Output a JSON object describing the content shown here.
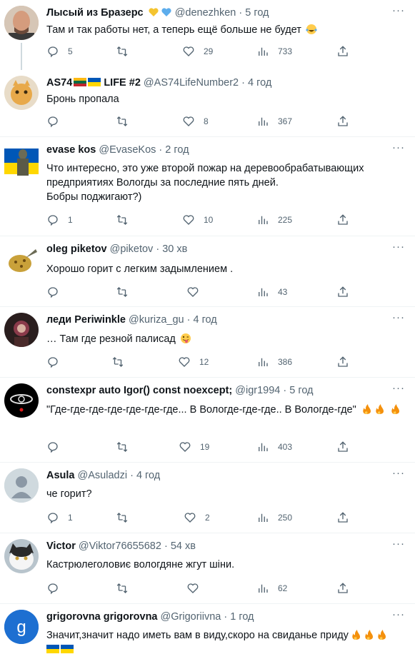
{
  "tweets": [
    {
      "name": "Лысый из Бразерс",
      "handle": "@denezhken",
      "sep": " · ",
      "time": "5 год",
      "text": "Там и так работы нет, а теперь ещё больше не будет",
      "replies": "5",
      "retweets": "",
      "likes": "29",
      "views": "733"
    },
    {
      "name": "AS74",
      "name2": "LIFE #2",
      "handle": "@AS74LifeNumber2",
      "sep": " · ",
      "time": "4 год",
      "text": "Бронь пропала",
      "replies": "",
      "retweets": "",
      "likes": "8",
      "views": "367"
    },
    {
      "name": "evase kos",
      "handle": "@EvaseKos",
      "sep": " · ",
      "time": "2 год",
      "text": "Что интересно, это уже второй пожар на деревообрабатывающих\nпредприятиях Вологды за последние пять дней.\nБобры поджигают?)",
      "replies": "1",
      "retweets": "",
      "likes": "10",
      "views": "225"
    },
    {
      "name": "oleg piketov",
      "handle": "@piketov",
      "sep": " · ",
      "time": "30 хв",
      "text": "Хорошо горит с легким задымлением .",
      "replies": "",
      "retweets": "",
      "likes": "",
      "views": "43"
    },
    {
      "name": "леди Periwinkle",
      "handle": "@kuriza_gu",
      "sep": " · ",
      "time": "4 год",
      "text": "… Там где резной палисад",
      "replies": "",
      "retweets": "",
      "likes": "12",
      "views": "386"
    },
    {
      "name": "constexpr auto Igor() const noexcept;",
      "handle": "@igr1994",
      "sep": " · ",
      "time": "5 год",
      "text": "\"Где-где-где-где-где-где-где... В Вологде-где-где.. В Вологде-где\"",
      "replies": "",
      "retweets": "",
      "likes": "19",
      "views": "403"
    },
    {
      "name": "Asula",
      "handle": "@Asuladzi",
      "sep": " · ",
      "time": "4 год",
      "text": "че горит?",
      "replies": "1",
      "retweets": "",
      "likes": "2",
      "views": "250"
    },
    {
      "name": "Victor",
      "handle": "@Viktor76655682",
      "sep": " · ",
      "time": "54 хв",
      "text": "Кастрюлеголовиє вологдяне жгут шіни.",
      "replies": "",
      "retweets": "",
      "likes": "",
      "views": "62"
    },
    {
      "name": "grigorovna grigorovna",
      "handle": "@Grigoriivna",
      "sep": " · ",
      "time": "1 год",
      "text": "Значит,значит надо иметь вам в виду,скоро на свиданье приду",
      "replies": "",
      "retweets": "",
      "likes": "",
      "views": ""
    }
  ],
  "avatar_letter": "g",
  "colors": {
    "accent": "#1d9bf0",
    "muted": "#536471",
    "divider": "#eff3f4",
    "heart_emoji": "#f4c430",
    "blue_heart": "#5dadec",
    "fire": "#f4900c"
  },
  "icons": [
    "reply-icon",
    "retweet-icon",
    "like-icon",
    "views-icon",
    "share-icon",
    "more-icon"
  ]
}
